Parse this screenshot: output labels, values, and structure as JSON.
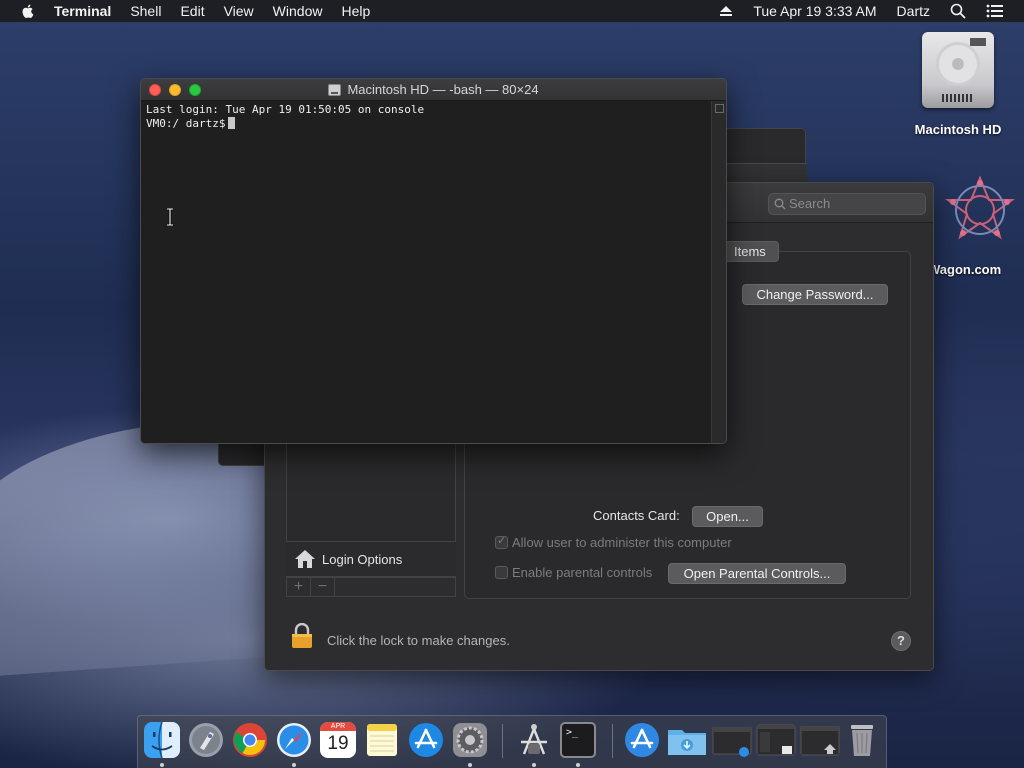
{
  "menubar": {
    "app_name": "Terminal",
    "menus": [
      "Shell",
      "Edit",
      "View",
      "Window",
      "Help"
    ],
    "datetime": "Tue Apr 19  3:33 AM",
    "user": "Dartz"
  },
  "desktop": {
    "icons": [
      {
        "label": "Macintosh HD"
      },
      {
        "label": "Wagon.com"
      }
    ]
  },
  "terminal": {
    "title": "Macintosh HD — -bash — 80×24",
    "lines": [
      "Last login: Tue Apr 19 01:50:05 on console",
      "VM0:/ dartz$"
    ]
  },
  "prefs": {
    "search_placeholder": "Search",
    "tab_label": "Items",
    "change_password": "Change Password...",
    "contacts_label": "Contacts Card:",
    "open_button": "Open...",
    "allow_admin": "Allow user to administer this computer",
    "allow_admin_checked": true,
    "parental_controls": "Enable parental controls",
    "parental_checked": false,
    "open_parental": "Open Parental Controls...",
    "login_options": "Login Options",
    "plus": "+",
    "minus": "−",
    "lock_text": "Click the lock to make changes.",
    "help": "?"
  },
  "dock": {
    "apps": [
      {
        "name": "Finder",
        "icon": "finder-icon",
        "running": true
      },
      {
        "name": "Launchpad",
        "icon": "launchpad-icon",
        "running": false
      },
      {
        "name": "Chrome",
        "icon": "chrome-icon",
        "running": false
      },
      {
        "name": "Safari",
        "icon": "safari-icon",
        "running": true
      },
      {
        "name": "Calendar",
        "icon": "calendar-icon",
        "running": false,
        "month": "APR",
        "day": "19"
      },
      {
        "name": "Notes",
        "icon": "notes-icon",
        "running": false
      },
      {
        "name": "App Store",
        "icon": "app-store-icon",
        "running": false
      },
      {
        "name": "System Preferences",
        "icon": "system-preferences-icon",
        "running": true
      },
      {
        "name": "Directory Utility",
        "icon": "directory-utility-icon",
        "running": true
      },
      {
        "name": "Terminal",
        "icon": "terminal-icon",
        "running": true,
        "glyph": ">_"
      },
      {
        "name": "Applications",
        "icon": "applications-folder-icon",
        "running": false
      },
      {
        "name": "Downloads",
        "icon": "downloads-folder-icon",
        "running": false
      },
      {
        "name": "Window 1",
        "icon": "minimized-window-icon",
        "running": false
      },
      {
        "name": "Window 2",
        "icon": "minimized-window-icon",
        "running": false
      },
      {
        "name": "Window 3",
        "icon": "minimized-window-icon",
        "running": false
      },
      {
        "name": "Trash",
        "icon": "trash-icon",
        "running": false
      }
    ]
  },
  "colors": {
    "close": "#ff5f57",
    "minimize": "#febc2e",
    "maximize": "#28c840",
    "accent": "#5b5b5e"
  }
}
